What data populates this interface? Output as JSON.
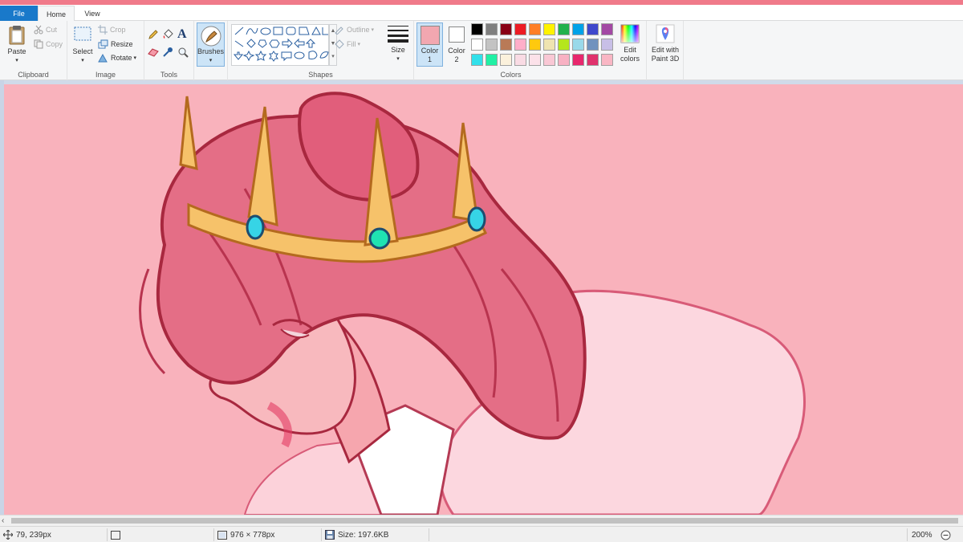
{
  "menu": {
    "file": "File",
    "tabs": [
      {
        "label": "Home",
        "active": true
      },
      {
        "label": "View",
        "active": false
      }
    ]
  },
  "ribbon": {
    "clipboard": {
      "paste": "Paste",
      "cut": "Cut",
      "copy": "Copy",
      "group_label": "Clipboard"
    },
    "image": {
      "select": "Select",
      "crop": "Crop",
      "resize": "Resize",
      "rotate": "Rotate",
      "group_label": "Image"
    },
    "tools": {
      "group_label": "Tools",
      "icons": [
        "pencil-icon",
        "fill-bucket-icon",
        "text-icon",
        "eraser-icon",
        "color-picker-icon",
        "magnifier-icon"
      ]
    },
    "brushes": {
      "label": "Brushes"
    },
    "shapes": {
      "outline": "Outline",
      "fill": "Fill",
      "group_label": "Shapes"
    },
    "size": {
      "label": "Size"
    },
    "color1": {
      "label": "Color",
      "index": "1",
      "value": "#f2a7b0"
    },
    "color2": {
      "label": "Color",
      "index": "2",
      "value": "#ffffff"
    },
    "colors": {
      "group_label": "Colors",
      "row1": [
        "#000000",
        "#7f7f7f",
        "#880015",
        "#ed1c24",
        "#ff7f27",
        "#fff200",
        "#22b14c",
        "#00a2e8",
        "#3f48cc",
        "#a349a4"
      ],
      "row2": [
        "#ffffff",
        "#c3c3c3",
        "#b97a57",
        "#ffaec9",
        "#ffc90e",
        "#efe4b0",
        "#b5e61d",
        "#99d9ea",
        "#7092be",
        "#c8bfe7"
      ],
      "row3": [
        "#32e0ea",
        "#21f0a5",
        "#fbf1dc",
        "#f9dbe4",
        "#fbe1e9",
        "#f9c8d5",
        "#f8b1c3",
        "#e8276d",
        "#e0326d",
        "#f9b6c4"
      ]
    },
    "edit_colors": {
      "line1": "Edit",
      "line2": "colors"
    },
    "paint3d": {
      "line1": "Edit with",
      "line2": "Paint 3D"
    }
  },
  "status": {
    "cursor_position": "79, 239px",
    "canvas_size": "976 × 778px",
    "file_size": "Size: 197.6KB",
    "zoom": "200%"
  },
  "canvas": {
    "background": "#f9b2bc",
    "subject": "drawing of a pink-haired person wearing a golden crown"
  }
}
